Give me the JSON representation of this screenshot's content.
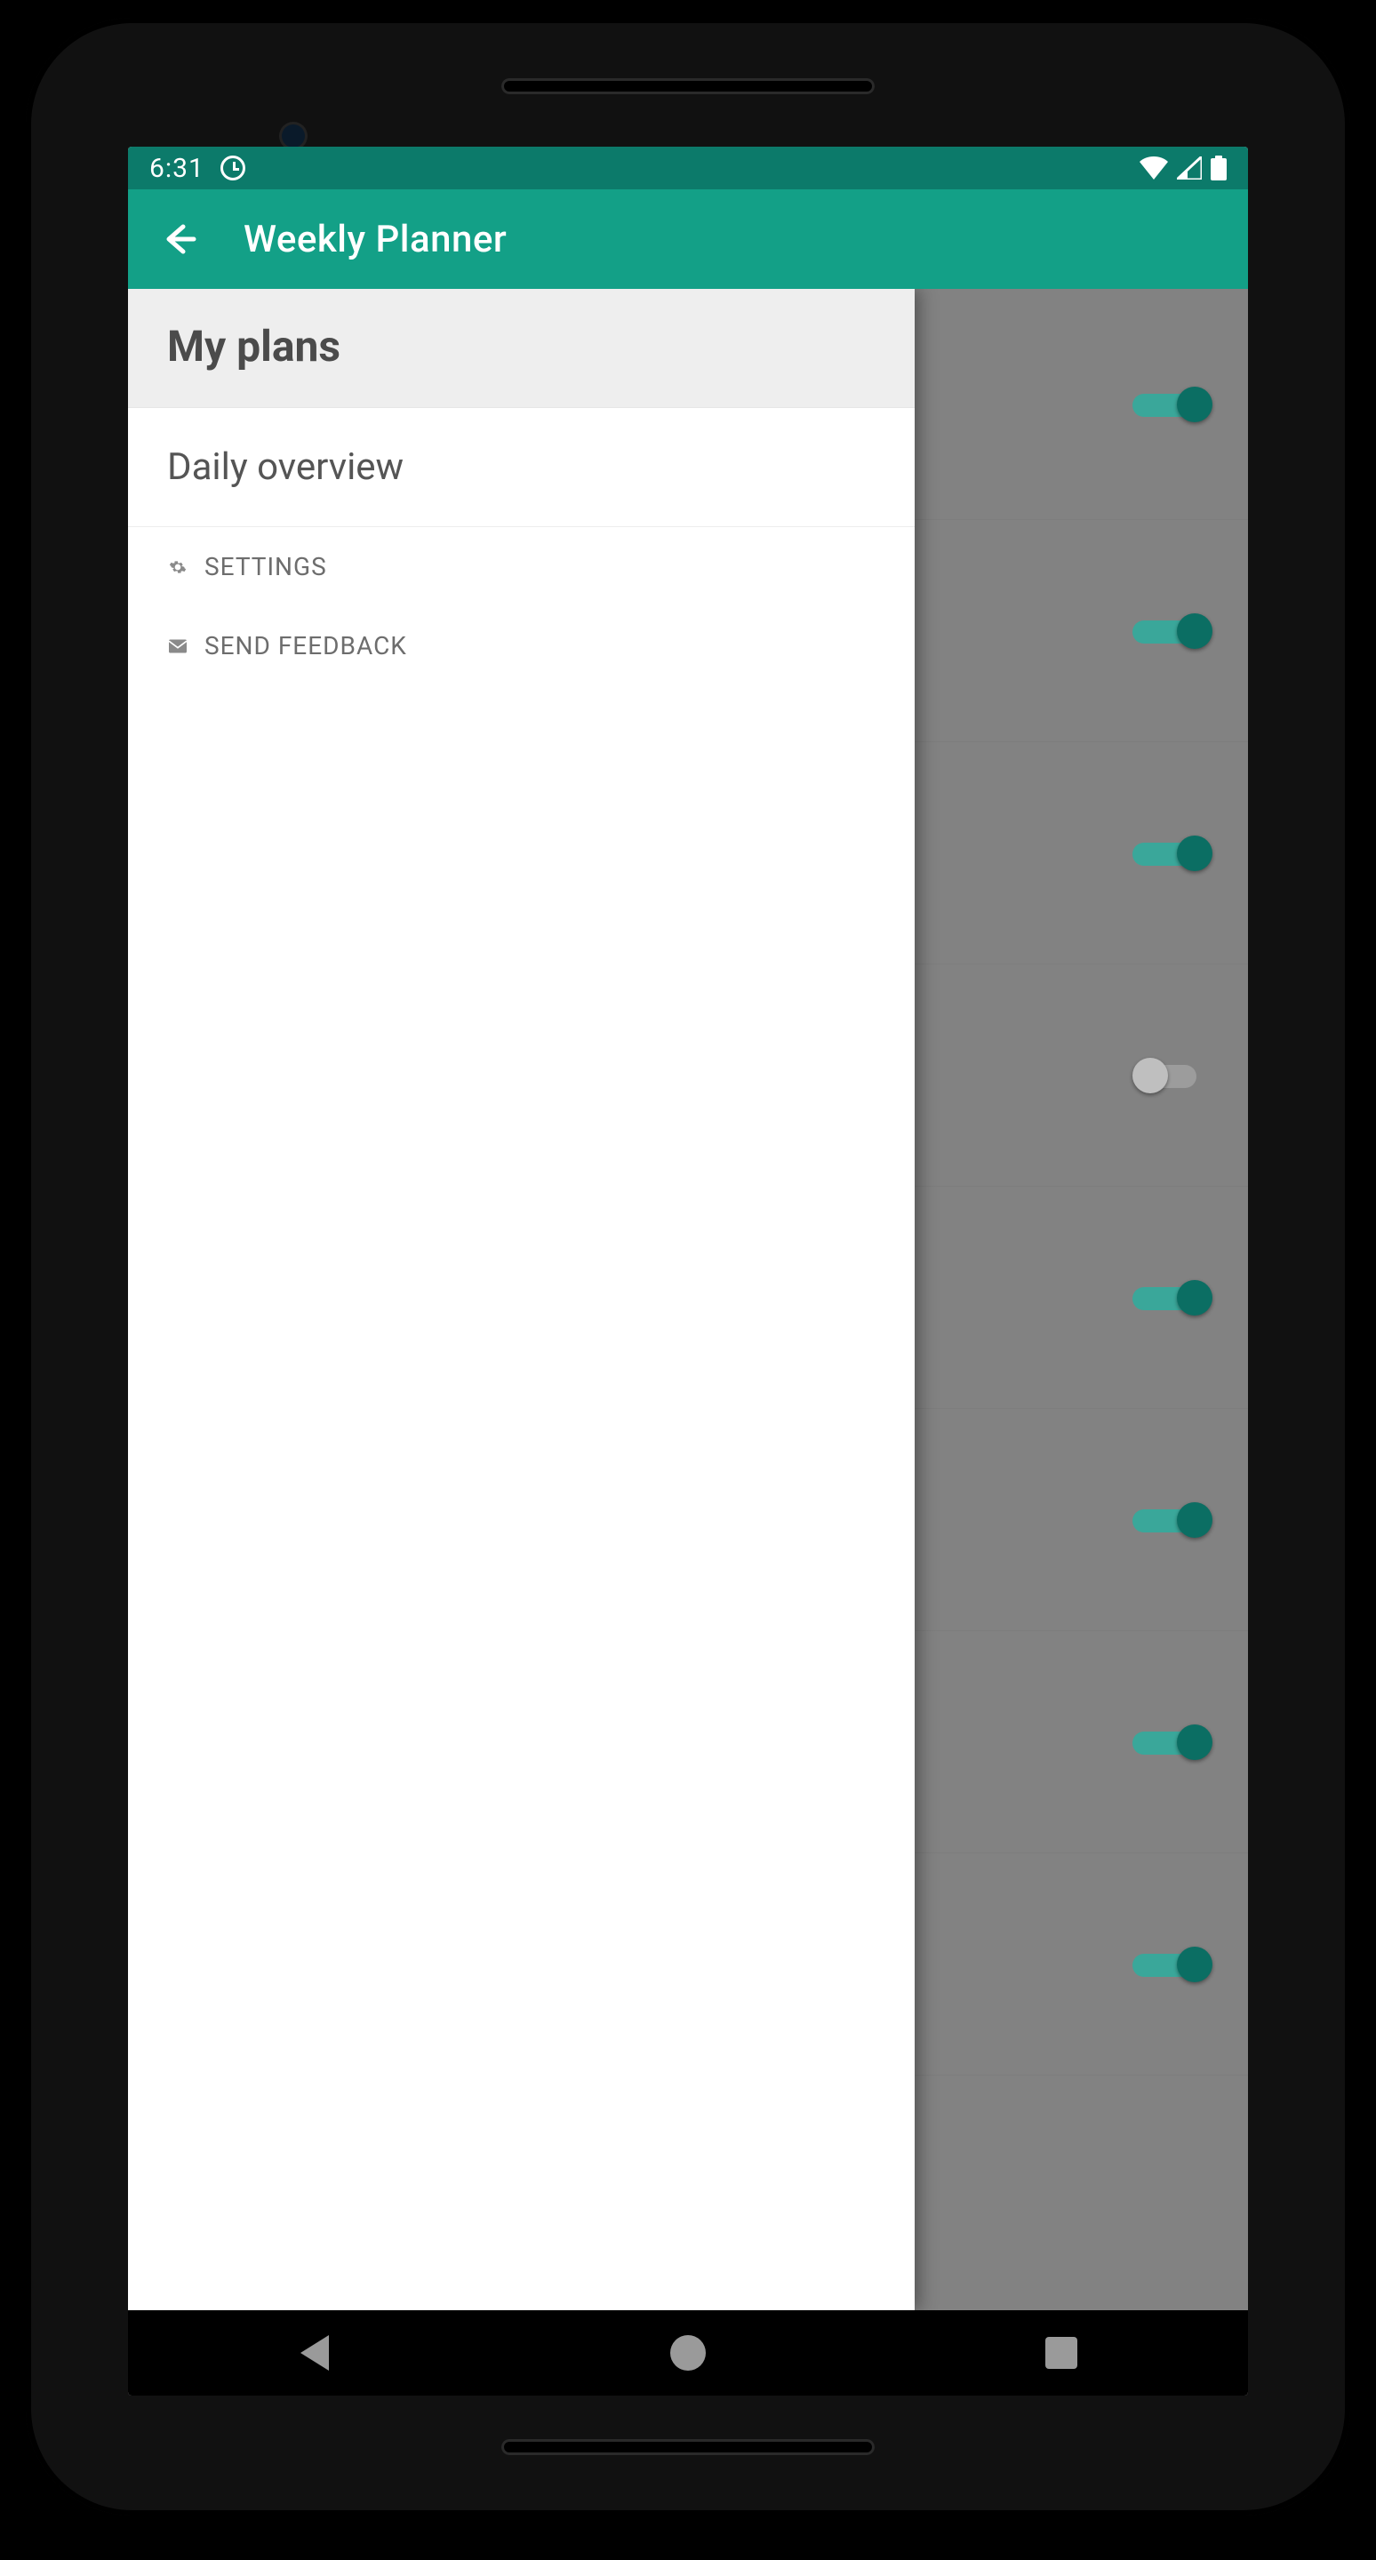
{
  "statusbar": {
    "time": "6:31"
  },
  "appbar": {
    "title": "Weekly Planner"
  },
  "drawer": {
    "header": "My plans",
    "items": {
      "overview": "Daily overview"
    },
    "settings_label": "SETTINGS",
    "feedback_label": "SEND FEEDBACK"
  },
  "background_toggles": [
    {
      "on": true
    },
    {
      "on": true
    },
    {
      "on": true
    },
    {
      "on": false
    },
    {
      "on": true
    },
    {
      "on": true
    },
    {
      "on": true
    },
    {
      "on": true
    }
  ]
}
